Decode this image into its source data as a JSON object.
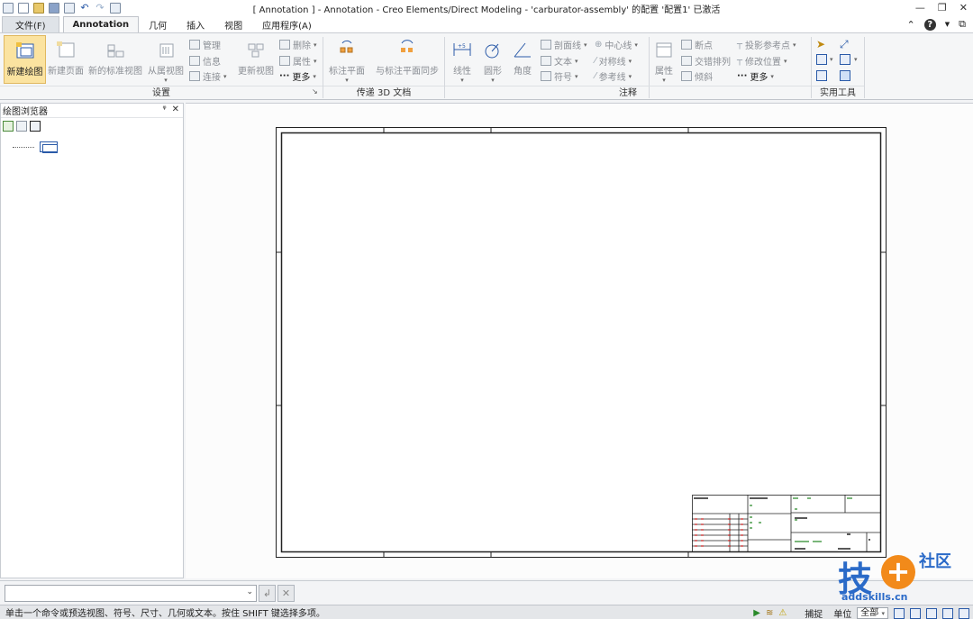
{
  "title_bar": {
    "title": "[ Annotation ] - Annotation - Creo Elements/Direct Modeling - 'carburator-assembly' 的配置 '配置1' 已激活"
  },
  "menubar": {
    "tabs": [
      {
        "label": "文件(F)"
      },
      {
        "label": "Annotation"
      },
      {
        "label": "几何"
      },
      {
        "label": "插入"
      },
      {
        "label": "视图"
      },
      {
        "label": "应用程序(A)"
      }
    ]
  },
  "ribbon": {
    "setup": {
      "new_drawing": "新建绘图",
      "new_page": "新建页面",
      "new_std_view": "新的标准视图",
      "from_view": "从属视图",
      "manage": "管理",
      "info": "信息",
      "connect": "连接",
      "update_view": "更新视图",
      "delete": "删除",
      "properties": "属性",
      "more": "更多",
      "group_label": "设置"
    },
    "transfer": {
      "annotation_plane": "标注平面",
      "sync_plane": "与标注平面同步",
      "group_label": "传递 3D 文档"
    },
    "annotation": {
      "linear": "线性",
      "circle": "圆形",
      "angle": "角度",
      "hatch": "剖面线",
      "text": "文本",
      "symbol": "符号",
      "centerline": "中心线",
      "symmetry": "对称线",
      "reference": "参考线",
      "properties": "属性",
      "break": "断点",
      "stagger": "交错排列",
      "tilt": "倾斜",
      "proj_ref": "投影参考点",
      "modify_pos": "修改位置",
      "more": "更多",
      "group_label": "注释"
    },
    "tools": {
      "group_label": "实用工具"
    }
  },
  "browser": {
    "title": "绘图浏览器"
  },
  "command": {
    "value": ""
  },
  "status": {
    "message": "单击一个命令或预选视图、符号、尺寸、几何或文本。按住 SHIFT 键选择多项。",
    "snap": "捕捉",
    "unit": "单位",
    "filter": "全部"
  },
  "watermark": {
    "big": "技",
    "side": "社区",
    "url": "addskills.cn"
  },
  "colors": {
    "ribbon_bg": "#f5f6f7",
    "selected": "#fbe3a0",
    "accent": "#2a5aa8"
  }
}
